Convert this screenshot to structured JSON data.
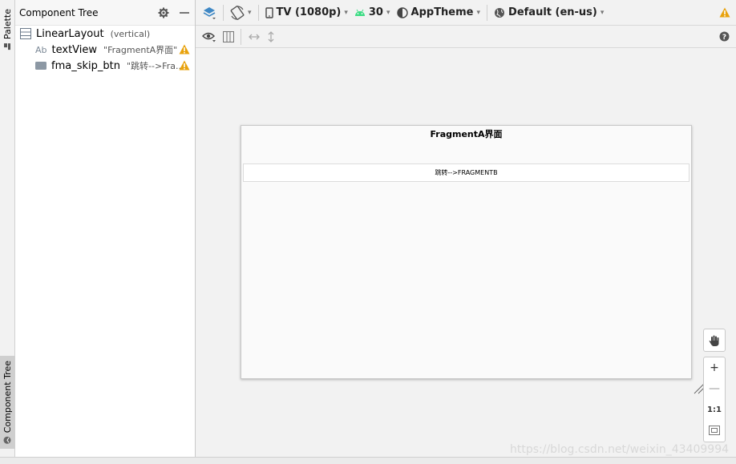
{
  "left_strip": {
    "palette_label": "Palette",
    "tree_label": "Component Tree"
  },
  "tree_panel": {
    "title": "Component Tree",
    "rows": [
      {
        "name": "LinearLayout",
        "detail": "(vertical)",
        "icon": "linear-layout-icon",
        "warning": false
      },
      {
        "prefix": "Ab",
        "name": "textView",
        "detail": "\"FragmentA界面\"",
        "icon": "text-view-icon",
        "warning": true
      },
      {
        "name": "fma_skip_btn",
        "detail": "\"跳转-->Fra...",
        "icon": "button-widget-icon",
        "warning": true
      }
    ]
  },
  "toolbar": {
    "device": "TV (1080p)",
    "api_level": "30",
    "theme": "AppTheme",
    "locale": "Default (en-us)"
  },
  "preview": {
    "title": "FragmentA界面",
    "button_label": "跳转-->FRAGMENTB"
  },
  "zoom": {
    "zoom_in": "+",
    "zoom_out": "—",
    "actual_size": "1:1"
  },
  "watermark": "https://blog.csdn.net/weixin_43409994",
  "colors": {
    "warning": "#e8a20c",
    "layers_accent": "#3f88c5",
    "android_green": "#3ddc84"
  }
}
